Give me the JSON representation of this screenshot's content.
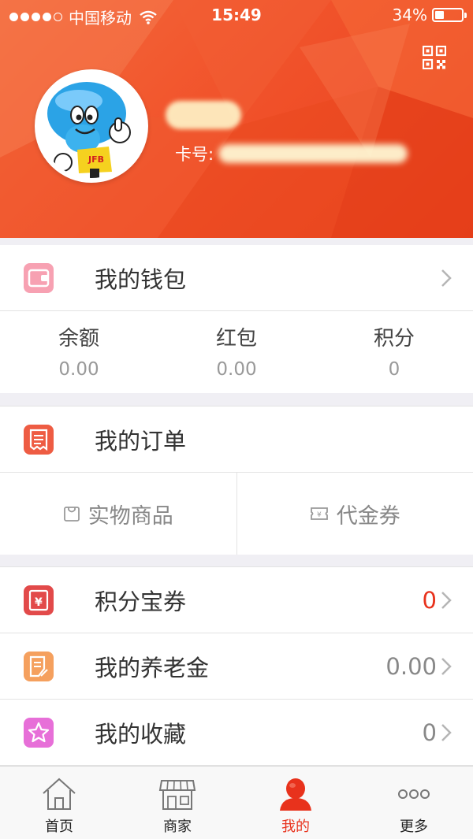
{
  "status_bar": {
    "carrier": "中国移动",
    "time": "15:49",
    "battery_percent": "34%",
    "battery_level": 0.34
  },
  "profile": {
    "card_label": "卡号:",
    "avatar_badge": "JFB"
  },
  "wallet": {
    "title": "我的钱包",
    "stats": [
      {
        "label": "余额",
        "value": "0.00"
      },
      {
        "label": "红包",
        "value": "0.00"
      },
      {
        "label": "积分",
        "value": "0"
      }
    ]
  },
  "orders": {
    "title": "我的订单",
    "tabs": [
      {
        "label": "实物商品",
        "icon": "bag-icon"
      },
      {
        "label": "代金券",
        "icon": "voucher-icon"
      }
    ]
  },
  "menu": [
    {
      "label": "积分宝券",
      "value": "0",
      "icon": "yuan-ticket-icon"
    },
    {
      "label": "我的养老金",
      "value": "0.00",
      "icon": "document-edit-icon"
    },
    {
      "label": "我的收藏",
      "value": "0",
      "icon": "star-icon"
    }
  ],
  "tabbar": [
    {
      "label": "首页",
      "icon": "home-icon"
    },
    {
      "label": "商家",
      "icon": "store-icon"
    },
    {
      "label": "我的",
      "icon": "person-icon",
      "active": true
    },
    {
      "label": "更多",
      "icon": "more-icon"
    }
  ],
  "colors": {
    "brand": "#f1532b",
    "accent_red": "#e8321c",
    "wallet_icon": "#f7a1b2",
    "orders_icon": "#ee5c43",
    "points_icon": "#e24a4a",
    "pension_icon": "#f5a05e",
    "favorite_icon": "#e76fd8"
  }
}
